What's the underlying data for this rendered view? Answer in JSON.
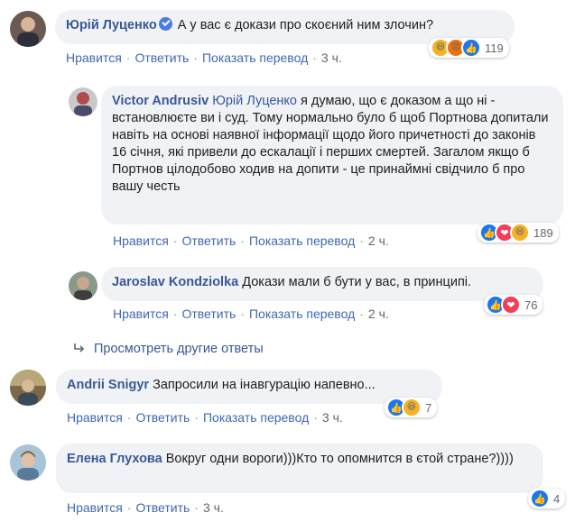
{
  "comments": [
    {
      "author": "Юрій Луценко",
      "text": " А у вас є докази про скоєний ним злочин?",
      "actions": {
        "like": "Нравится",
        "reply": "Ответить",
        "translate": "Показать перевод",
        "time": "3 ч."
      },
      "reactions": {
        "icons": [
          "haha-icon",
          "angry-icon",
          "like-icon"
        ],
        "count": "119"
      }
    },
    {
      "author": "Victor Andrusiv",
      "mention": "Юрій Луценко",
      "text": "я думаю, що є доказом а що ні - встановлюєте ви і суд. Тому нормально було б щоб Портнова допитали навіть на основі наявної інформації щодо його причетності до законів 16 січня, які привели до ескалації і перших смертей. Загалом якщо б Портнов цілодобово ходив на допити - це принаймні свідчило б про вашу честь",
      "actions": {
        "like": "Нравится",
        "reply": "Ответить",
        "translate": "Показать перевод",
        "time": "2 ч."
      },
      "reactions": {
        "icons": [
          "like-icon",
          "love-icon",
          "haha-icon"
        ],
        "count": "189"
      }
    },
    {
      "author": "Jaroslav Kondziolka",
      "text": "Докази мали б бути у вас, в принципі.",
      "actions": {
        "like": "Нравится",
        "reply": "Ответить",
        "translate": "Показать перевод",
        "time": "2 ч."
      },
      "reactions": {
        "icons": [
          "like-icon",
          "love-icon"
        ],
        "count": "76"
      }
    },
    {
      "author": "Andrii Snigyr",
      "text": "Запросили на інавгурацію напевно...",
      "actions": {
        "like": "Нравится",
        "reply": "Ответить",
        "translate": "Показать перевод",
        "time": "3 ч."
      },
      "reactions": {
        "icons": [
          "like-icon",
          "haha-icon"
        ],
        "count": "7"
      }
    },
    {
      "author": "Елена Глухова",
      "text": "Вокруг одни вороги)))Кто то опомнится в єтой стране?))))",
      "actions": {
        "like": "Нравится",
        "reply": "Ответить",
        "time": "3 ч."
      },
      "reactions": {
        "icons": [
          "like-icon"
        ],
        "count": "4"
      }
    }
  ],
  "more_replies": "Просмотреть другие ответы",
  "colors": {
    "link": "#385898",
    "bubble": "#f0f2f5",
    "like": "#1877f2",
    "love": "#f33e58",
    "haha": "#f7b125"
  }
}
